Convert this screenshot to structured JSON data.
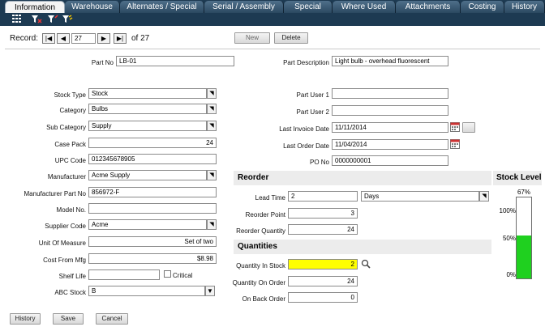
{
  "tabs": [
    "Information",
    "Warehouse",
    "Alternates / Special",
    "Serial / Assembly",
    "Special",
    "Where Used",
    "Attachments",
    "Costing",
    "History"
  ],
  "toolbar_icons": [
    "grid-icon",
    "filter-clear-icon",
    "filter-icon",
    "filter-apply-icon"
  ],
  "record": {
    "label": "Record:",
    "current": "27",
    "of_text": "of 27"
  },
  "actions": {
    "new": "New",
    "delete": "Delete"
  },
  "form_left": {
    "part_no": {
      "label": "Part No",
      "value": "LB-01"
    },
    "stock_type": {
      "label": "Stock Type",
      "value": "Stock"
    },
    "category": {
      "label": "Category",
      "value": "Bulbs"
    },
    "sub_category": {
      "label": "Sub Category",
      "value": "Supply"
    },
    "case_pack": {
      "label": "Case Pack",
      "value": "24"
    },
    "upc_code": {
      "label": "UPC Code",
      "value": "012345678905"
    },
    "manufacturer": {
      "label": "Manufacturer",
      "value": "Acme Supply"
    },
    "manufacturer_part_no": {
      "label": "Manufacturer Part No",
      "value": "856972-F"
    },
    "model_no": {
      "label": "Model No.",
      "value": ""
    },
    "supplier_code": {
      "label": "Supplier Code",
      "value": "Acme"
    },
    "unit_of_measure": {
      "label": "Unit Of Measure",
      "value": "Set of two"
    },
    "cost_from_mfg": {
      "label": "Cost From Mfg",
      "value": "$8.98"
    },
    "shelf_life": {
      "label": "Shelf Life",
      "value": ""
    },
    "critical": {
      "label": "Critical"
    },
    "abc_stock": {
      "label": "ABC Stock",
      "value": "B"
    }
  },
  "form_right": {
    "part_description": {
      "label": "Part Description",
      "value": "Light bulb - overhead fluorescent"
    },
    "part_user_1": {
      "label": "Part User 1",
      "value": ""
    },
    "part_user_2": {
      "label": "Part User 2",
      "value": ""
    },
    "last_invoice_date": {
      "label": "Last Invoice Date",
      "value": "11/11/2014"
    },
    "last_order_date": {
      "label": "Last Order Date",
      "value": "11/04/2014"
    },
    "po_no": {
      "label": "PO No",
      "value": "0000000001"
    }
  },
  "reorder": {
    "title": "Reorder",
    "lead_time": {
      "label": "Lead Time",
      "value": "2",
      "unit": "Days"
    },
    "reorder_point": {
      "label": "Reorder Point",
      "value": "3"
    },
    "reorder_quantity": {
      "label": "Reorder Quantity",
      "value": "24"
    }
  },
  "quantities": {
    "title": "Quantities",
    "in_stock": {
      "label": "Quantity In Stock",
      "value": "2"
    },
    "on_order": {
      "label": "Quantity On Order",
      "value": "24"
    },
    "back_order": {
      "label": "On Back Order",
      "value": "0"
    }
  },
  "stock_level": {
    "title": "Stock Level",
    "percent_label": "67%",
    "ticks": [
      "100%",
      "50%",
      "0%"
    ],
    "fill_fraction": 0.53,
    "fill_color": "#1fd01f"
  },
  "footer": {
    "history": "History",
    "save": "Save",
    "cancel": "Cancel"
  },
  "colors": {
    "tabbar": "#1d3a52",
    "highlight_field": "#ffff00"
  }
}
